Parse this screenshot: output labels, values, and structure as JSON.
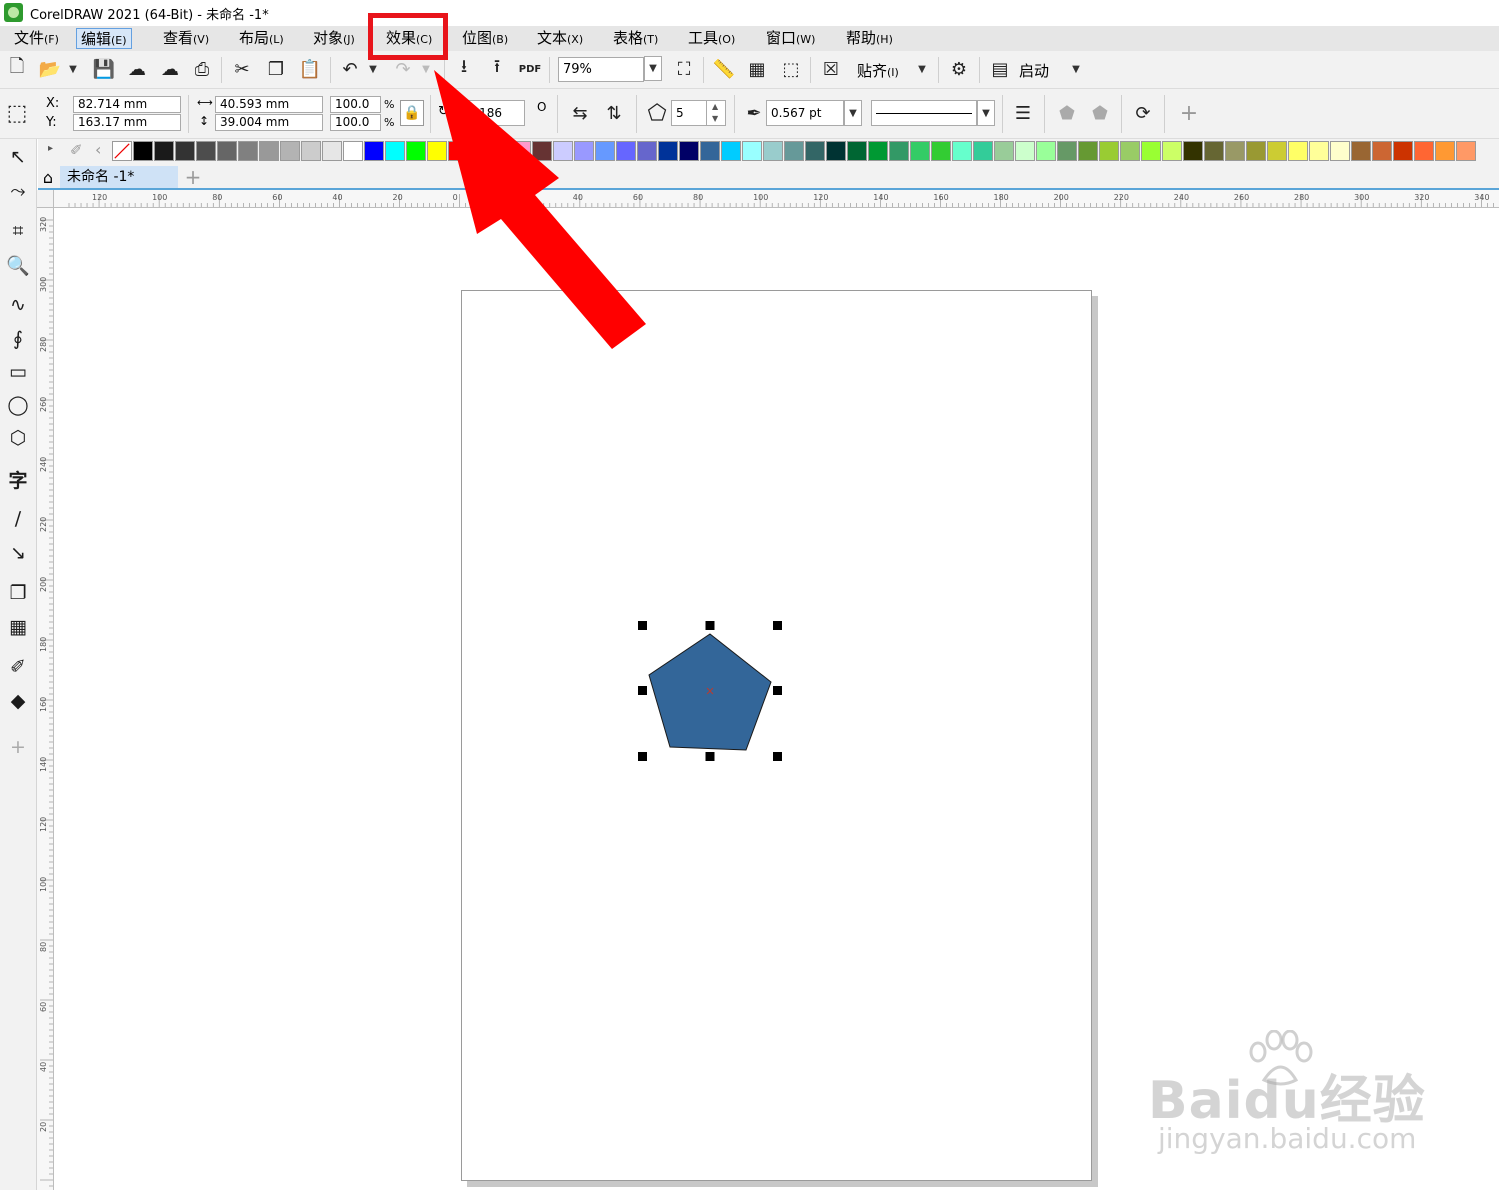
{
  "window": {
    "title": "CorelDRAW 2021 (64-Bit) - 未命名 -1*"
  },
  "menu": [
    {
      "label": "文件",
      "accel": "(F)"
    },
    {
      "label": "编辑",
      "accel": "(E)"
    },
    {
      "label": "查看",
      "accel": "(V)"
    },
    {
      "label": "布局",
      "accel": "(L)"
    },
    {
      "label": "对象",
      "accel": "(J)"
    },
    {
      "label": "效果",
      "accel": "(C)"
    },
    {
      "label": "位图",
      "accel": "(B)"
    },
    {
      "label": "文本",
      "accel": "(X)"
    },
    {
      "label": "表格",
      "accel": "(T)"
    },
    {
      "label": "工具",
      "accel": "(O)"
    },
    {
      "label": "窗口",
      "accel": "(W)"
    },
    {
      "label": "帮助",
      "accel": "(H)"
    }
  ],
  "toolbar": {
    "pdf_label": "PDF",
    "zoom_value": "79%",
    "snap_label": "贴齐",
    "snap_accel": "(I)",
    "launch_label": "启动"
  },
  "properties": {
    "x_label": "X:",
    "y_label": "Y:",
    "x_value": "82.714 mm",
    "y_value": "163.17 mm",
    "width_value": "40.593 mm",
    "height_value": "39.004 mm",
    "scale_x": "100.0",
    "scale_y": "100.0",
    "percent_sign": "%",
    "rotation_value": "14.186",
    "degree_sign": "O",
    "polygon_points": "5",
    "outline_width": "0.567 pt"
  },
  "document": {
    "tab_label": "未命名 -1*"
  },
  "ruler": {
    "h_labels": [
      "120",
      "100",
      "80",
      "60",
      "40",
      "20",
      "0",
      "20",
      "40",
      "60",
      "80",
      "100",
      "120",
      "140",
      "160",
      "180",
      "200",
      "220",
      "240",
      "260",
      "280",
      "300",
      "320",
      "340"
    ],
    "v_labels": [
      "320",
      "300",
      "280",
      "260",
      "240",
      "220",
      "200",
      "180",
      "160",
      "140",
      "120",
      "100",
      "80",
      "60",
      "40",
      "20"
    ]
  },
  "palette": [
    "#000000",
    "#1a1a1a",
    "#333333",
    "#4d4d4d",
    "#666666",
    "#808080",
    "#999999",
    "#b3b3b3",
    "#cccccc",
    "#e6e6e6",
    "#ffffff",
    "#0000ff",
    "#00ffff",
    "#00ff00",
    "#ffff00",
    "#ff0000",
    "#ff00ff",
    "#ff8000",
    "#ff99cc",
    "#663333",
    "#ccccff",
    "#9999ff",
    "#6699ff",
    "#6666ff",
    "#6666cc",
    "#003399",
    "#000066",
    "#336699",
    "#00ccff",
    "#99ffff",
    "#99cccc",
    "#669999",
    "#336666",
    "#003333",
    "#006633",
    "#009933",
    "#339966",
    "#33cc66",
    "#33cc33",
    "#66ffcc",
    "#33cc99",
    "#99cc99",
    "#ccffcc",
    "#99ff99",
    "#669966",
    "#669933",
    "#99cc33",
    "#99cc66",
    "#99ff33",
    "#ccff66",
    "#333300",
    "#666633",
    "#999966",
    "#999933",
    "#cccc33",
    "#ffff66",
    "#ffff99",
    "#ffffcc",
    "#996633",
    "#cc6633",
    "#cc3300",
    "#ff6633",
    "#ff9933",
    "#ff9966"
  ],
  "colors": {
    "shape_fill": "#336699",
    "highlight": "#e8141b",
    "arrow": "#ff0000"
  },
  "watermark": {
    "main": "Baidu经验",
    "sub": "jingyan.baidu.com"
  }
}
